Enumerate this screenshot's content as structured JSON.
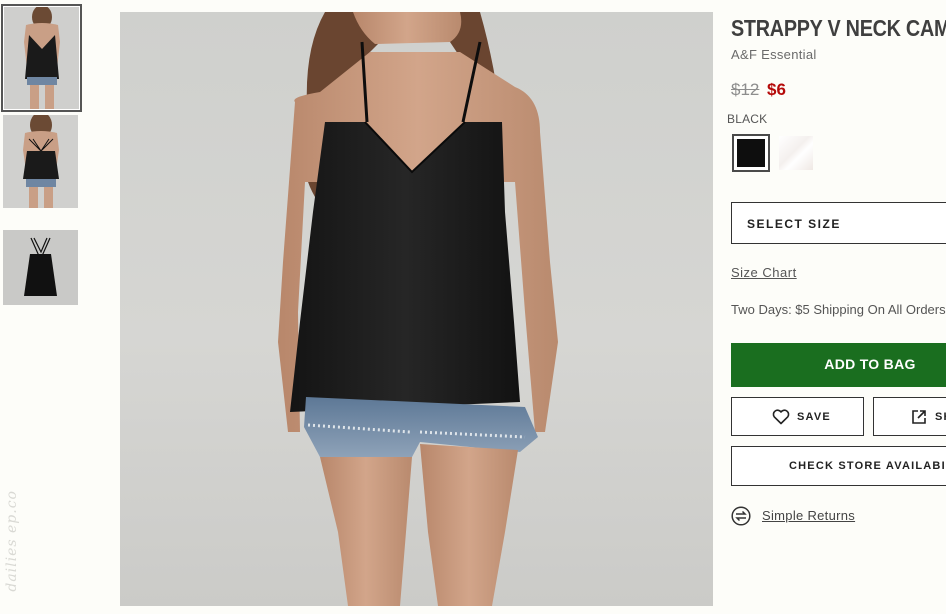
{
  "product": {
    "title": "STRAPPY V NECK CAMI",
    "brand": "A&F Essential",
    "price_original": "$12",
    "price_sale": "$6",
    "selected_color": "BLACK"
  },
  "actions": {
    "select_size": "SELECT SIZE",
    "size_chart": "Size Chart",
    "shipping_note": "Two Days: $5 Shipping On All Orders",
    "add_to_bag": "ADD TO BAG",
    "save": "SAVE",
    "share": "SH",
    "check_store": "CHECK STORE AVAILABILITY",
    "returns": "Simple Returns"
  },
  "watermark": "dailies ep.co",
  "colors": {
    "sale_price": "#b50a0a",
    "add_to_bag": "#1a6e1f",
    "swatch_black": "#0e0e0e",
    "swatch_white": "#f4f0ee"
  },
  "icons": {
    "save": "heart-icon",
    "share": "external-link-icon",
    "returns": "exchange-arrows-icon"
  }
}
